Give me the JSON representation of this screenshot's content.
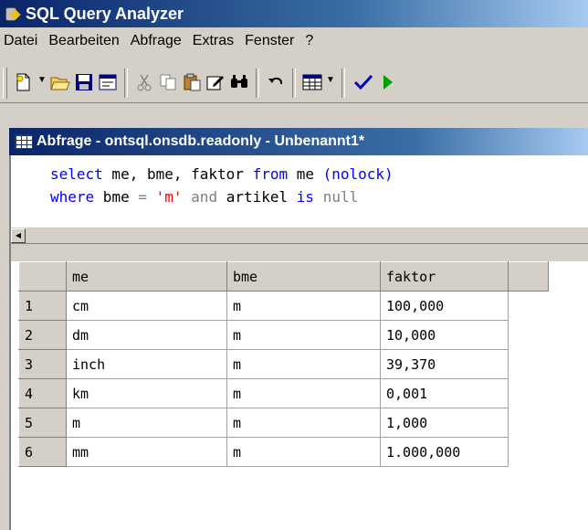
{
  "window": {
    "title": "SQL Query Analyzer",
    "app_icon": "sql-server-icon"
  },
  "menu": {
    "items": [
      "Datei",
      "Bearbeiten",
      "Abfrage",
      "Extras",
      "Fenster",
      "?"
    ]
  },
  "toolbar": {
    "buttons": [
      "new-query-icon",
      "open-icon",
      "save-icon",
      "load-script-icon",
      "cut-icon",
      "copy-icon",
      "paste-icon",
      "edit-icon",
      "find-icon",
      "undo-icon",
      "results-grid-icon",
      "parse-icon",
      "execute-icon"
    ]
  },
  "query_window": {
    "title": "Abfrage - ontsql.onsdb.readonly - Unbenannt1*",
    "code": {
      "line1": {
        "kw1": "select",
        "mid1": " me, bme, faktor ",
        "kw2": "from",
        "mid2": " me ",
        "hint": "(nolock)"
      },
      "line2": {
        "kw1": "where",
        "mid1": " bme ",
        "eq": "=",
        "sp": " ",
        "str": "'m'",
        "sp2": " ",
        "and": "and",
        "mid2": " artikel ",
        "is": "is",
        "sp3": " ",
        "null": "null"
      }
    }
  },
  "results": {
    "columns": [
      "me",
      "bme",
      "faktor"
    ],
    "rows": [
      {
        "num": "1",
        "me": "cm",
        "bme": "m",
        "faktor": "100,000"
      },
      {
        "num": "2",
        "me": "dm",
        "bme": "m",
        "faktor": "10,000"
      },
      {
        "num": "3",
        "me": "inch",
        "bme": "m",
        "faktor": "39,370"
      },
      {
        "num": "4",
        "me": "km",
        "bme": "m",
        "faktor": "0,001"
      },
      {
        "num": "5",
        "me": "m",
        "bme": "m",
        "faktor": "1,000"
      },
      {
        "num": "6",
        "me": "mm",
        "bme": "m",
        "faktor": "1.000,000"
      }
    ]
  }
}
